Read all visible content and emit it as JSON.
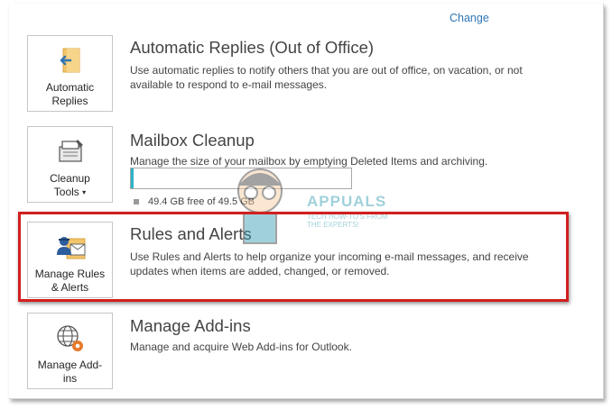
{
  "header": {
    "change_link": "Change"
  },
  "sections": [
    {
      "tile_label_line1": "Automatic",
      "tile_label_line2": "Replies",
      "title": "Automatic Replies (Out of Office)",
      "description": "Use automatic replies to notify others that you are out of office, on vacation, or not available to respond to e-mail messages.",
      "icon": "automatic-replies-icon"
    },
    {
      "tile_label_line1": "Cleanup",
      "tile_label_line2": "Tools",
      "tile_caret": "▾",
      "title": "Mailbox Cleanup",
      "description": "Manage the size of your mailbox by emptying Deleted Items and archiving.",
      "storage_text": "49.4 GB free of 49.5 GB",
      "storage_used_fraction": 0.002,
      "icon": "cleanup-tools-icon"
    },
    {
      "tile_label_line1": "Manage Rules",
      "tile_label_line2": "& Alerts",
      "title": "Rules and Alerts",
      "description": "Use Rules and Alerts to help organize your incoming e-mail messages, and receive updates when items are added, changed, or removed.",
      "icon": "manage-rules-icon"
    },
    {
      "tile_label_line1": "Manage Add-",
      "tile_label_line2": "ins",
      "title": "Manage Add-ins",
      "description": "Manage and acquire Web Add-ins for Outlook.",
      "icon": "manage-addins-icon"
    }
  ],
  "watermark": {
    "text": "APPUALS",
    "subtext": "TECH HOW-TO'S FROM THE EXPERTS!"
  },
  "colors": {
    "link": "#2e75b6",
    "highlight": "#d21f1f",
    "storage_fill": "#2bb3c7"
  }
}
